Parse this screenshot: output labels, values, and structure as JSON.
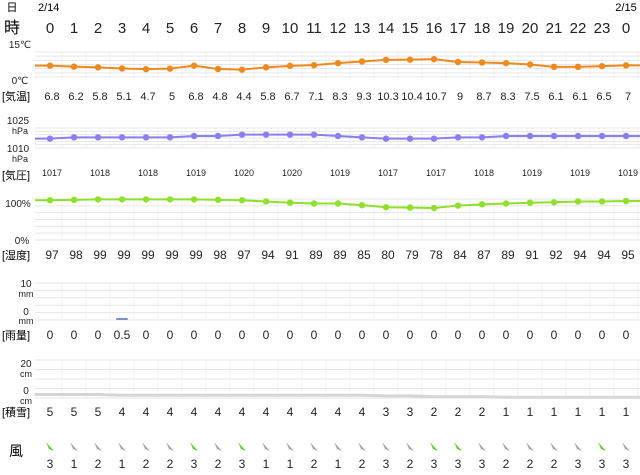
{
  "labels": {
    "day": "日",
    "hour": "時",
    "date_start": "2/14",
    "date_end": "2/15",
    "temp": "[気温]",
    "pressure": "[気圧]",
    "humidity": "[湿度]",
    "rain": "[雨量]",
    "snow": "[積雪]",
    "wind": "風"
  },
  "colors": {
    "temperature": "#ee8a1c",
    "pressure": "#8a7ef0",
    "humidity": "#8ee02a",
    "rain_bar": "#7a8fd8",
    "snow_line": "#d6d6d6",
    "wind_strong": "#5fcf1f",
    "wind_light": "#a7a7a7",
    "grid": "#e6e6e6"
  },
  "chart_data": {
    "type": "line",
    "hours": [
      "0",
      "1",
      "2",
      "3",
      "4",
      "5",
      "6",
      "7",
      "8",
      "9",
      "10",
      "11",
      "12",
      "13",
      "14",
      "15",
      "16",
      "17",
      "18",
      "19",
      "20",
      "21",
      "22",
      "23",
      "0"
    ],
    "temperature": {
      "axis_labels": [
        "15℃",
        "0℃"
      ],
      "ylim": [
        0,
        15
      ],
      "values": [
        6.8,
        6.2,
        5.8,
        5.1,
        4.7,
        5,
        6.8,
        4.8,
        4.4,
        5.8,
        6.7,
        7.1,
        8.3,
        9.3,
        10.3,
        10.4,
        10.7,
        9,
        8.7,
        8.3,
        7.5,
        6.1,
        6.1,
        6.5,
        7
      ],
      "value_labels": [
        "6.8",
        "6.2",
        "5.8",
        "5.1",
        "4.7",
        "5",
        "6.8",
        "4.8",
        "4.4",
        "5.8",
        "6.7",
        "7.1",
        "8.3",
        "9.3",
        "10.3",
        "10.4",
        "10.7",
        "9",
        "8.7",
        "8.3",
        "7.5",
        "6.1",
        "6.1",
        "6.5",
        "7"
      ]
    },
    "pressure": {
      "axis_labels": [
        "1025",
        "hPa",
        "1010",
        "hPa"
      ],
      "ylim": [
        1010,
        1025
      ],
      "values": [
        1017,
        1018,
        1018,
        1018,
        1018,
        1018,
        1019,
        1019,
        1020,
        1020,
        1020,
        1020,
        1019,
        1018,
        1017,
        1017,
        1017,
        1018,
        1018,
        1019,
        1019,
        1019,
        1019,
        1019,
        1019
      ],
      "value_labels": [
        "1017",
        "",
        "1018",
        "",
        "1018",
        "",
        "1019",
        "",
        "1020",
        "",
        "1020",
        "",
        "1019",
        "",
        "1017",
        "",
        "1017",
        "",
        "1018",
        "",
        "1019",
        "",
        "1019",
        "",
        "1019"
      ]
    },
    "humidity": {
      "axis_labels": [
        "100%",
        "0%"
      ],
      "ylim": [
        0,
        100
      ],
      "values": [
        97,
        98,
        99,
        99,
        99,
        99,
        99,
        98,
        97,
        94,
        91,
        89,
        89,
        85,
        80,
        79,
        78,
        84,
        87,
        89,
        91,
        92,
        94,
        94,
        95
      ],
      "value_labels": [
        "97",
        "98",
        "99",
        "99",
        "99",
        "99",
        "99",
        "98",
        "97",
        "94",
        "91",
        "89",
        "89",
        "85",
        "80",
        "79",
        "78",
        "84",
        "87",
        "89",
        "91",
        "92",
        "94",
        "94",
        "95"
      ]
    },
    "rain": {
      "axis_labels": [
        "10",
        "mm",
        "0",
        "mm"
      ],
      "ylim": [
        0,
        10
      ],
      "values": [
        0,
        0,
        0,
        0.5,
        0,
        0,
        0,
        0,
        0,
        0,
        0,
        0,
        0,
        0,
        0,
        0,
        0,
        0,
        0,
        0,
        0,
        0,
        0,
        0,
        0
      ],
      "value_labels": [
        "0",
        "0",
        "0",
        "0.5",
        "0",
        "0",
        "0",
        "0",
        "0",
        "0",
        "0",
        "0",
        "0",
        "0",
        "0",
        "0",
        "0",
        "0",
        "0",
        "0",
        "0",
        "0",
        "0",
        "0",
        "0"
      ]
    },
    "snow": {
      "axis_labels": [
        "20",
        "cm",
        "0",
        "cm"
      ],
      "ylim": [
        0,
        20
      ],
      "values": [
        5,
        5,
        5,
        4,
        4,
        4,
        4,
        4,
        4,
        4,
        4,
        4,
        4,
        4,
        3,
        3,
        2,
        2,
        2,
        1,
        1,
        1,
        1,
        1,
        1
      ],
      "value_labels": [
        "5",
        "5",
        "5",
        "4",
        "4",
        "4",
        "4",
        "4",
        "4",
        "4",
        "4",
        "4",
        "4",
        "4",
        "3",
        "3",
        "2",
        "2",
        "2",
        "1",
        "1",
        "1",
        "1",
        "1",
        "1"
      ]
    },
    "wind": {
      "speeds": [
        "3",
        "1",
        "2",
        "1",
        "2",
        "2",
        "3",
        "2",
        "3",
        "1",
        "1",
        "2",
        "1",
        "2",
        "3",
        "2",
        "3",
        "3",
        "3",
        "2",
        "2",
        "2",
        "3",
        "3",
        "3"
      ],
      "strong": [
        true,
        false,
        false,
        false,
        false,
        false,
        true,
        false,
        true,
        false,
        false,
        false,
        false,
        false,
        false,
        false,
        true,
        true,
        false,
        false,
        false,
        false,
        false,
        true,
        false
      ]
    }
  }
}
